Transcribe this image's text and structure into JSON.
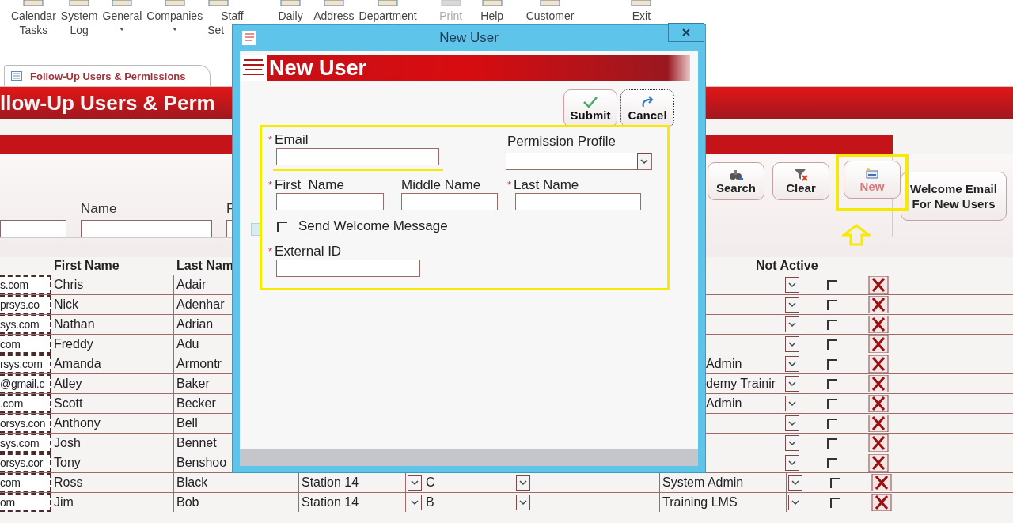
{
  "ribbon": {
    "items": [
      {
        "kind": "button",
        "lines": [
          "Calendar",
          "Tasks"
        ],
        "disabled": false
      },
      {
        "kind": "button",
        "lines": [
          "System",
          "Log"
        ],
        "disabled": false
      },
      {
        "kind": "dropdown",
        "lines": [
          "General"
        ],
        "disabled": false
      },
      {
        "kind": "dropdown",
        "lines": [
          "Companies"
        ],
        "disabled": false
      },
      {
        "kind": "button",
        "lines": [
          "Staff",
          "Set"
        ],
        "disabled": false
      },
      {
        "kind": "button",
        "lines": [
          "Daily"
        ],
        "disabled": false
      },
      {
        "kind": "button",
        "lines": [
          "Address"
        ],
        "disabled": false
      },
      {
        "kind": "button",
        "lines": [
          "Department"
        ],
        "disabled": false
      },
      {
        "kind": "button",
        "lines": [
          "Print"
        ],
        "disabled": true
      },
      {
        "kind": "button",
        "lines": [
          "Help"
        ],
        "disabled": false
      },
      {
        "kind": "button",
        "lines": [
          "Customer"
        ],
        "disabled": false
      },
      {
        "kind": "button",
        "lines": [
          "Exit"
        ],
        "disabled": false
      }
    ]
  },
  "document_tab": {
    "label": "Follow-Up Users & Permissions"
  },
  "form_title": "llow-Up Users & Perm",
  "search": {
    "fields": [
      {
        "kind": "bare"
      },
      {
        "kind": "labeled",
        "label": "Name"
      },
      {
        "kind": "labeled",
        "label": "F"
      }
    ]
  },
  "buttons": [
    {
      "kind": "search",
      "label": "Search",
      "highlighted": false
    },
    {
      "kind": "clear",
      "label": "Clear",
      "highlighted": false
    },
    {
      "kind": "new",
      "label": "New",
      "highlighted": true
    },
    {
      "kind": "text",
      "label": "Welcome Email For New Users",
      "highlighted": false
    }
  ],
  "table": {
    "columns": {
      "first": "First Name",
      "last": "Last Nam",
      "not_active": "Not Active"
    },
    "rows": [
      {
        "kind": "covered",
        "email": "s.com",
        "first": "Chris",
        "last": "Adair",
        "not_active": false
      },
      {
        "kind": "covered",
        "email": "prsys.co",
        "first": "Nick",
        "last": "Adenhar",
        "not_active": false
      },
      {
        "kind": "covered",
        "email": "sys.com",
        "first": "Nathan",
        "last": "Adrian",
        "not_active": false
      },
      {
        "kind": "covered",
        "email": "com",
        "first": "Freddy",
        "last": "Adu",
        "not_active": false
      },
      {
        "kind": "covered",
        "email": "rsys.com",
        "first": "Amanda",
        "last": "Armontr",
        "profile": "Admin",
        "not_active": false
      },
      {
        "kind": "covered",
        "email": "@gmail.c",
        "first": "Atley",
        "last": "Baker",
        "profile": "demy Trainir",
        "not_active": false
      },
      {
        "kind": "covered",
        "email": ".com",
        "first": "Scott",
        "last": "Becker",
        "profile": "Admin",
        "not_active": false
      },
      {
        "kind": "covered",
        "email": "orsys.con",
        "first": "Anthony",
        "last": "Bell",
        "not_active": false
      },
      {
        "kind": "covered",
        "email": "sys.com",
        "first": "Josh",
        "last": "Bennet",
        "not_active": false
      },
      {
        "kind": "covered",
        "email": "orsys.cor",
        "first": "Tony",
        "last": "Benshoo",
        "not_active": false
      },
      {
        "kind": "full",
        "email": "com",
        "first": "Ross",
        "last": "Black",
        "station": "Station 14",
        "level": "C",
        "profile": "System Admin",
        "not_active": false
      },
      {
        "kind": "full",
        "email": "om",
        "first": "Jim",
        "last": "Bob",
        "station": "Station 14",
        "level": "B",
        "profile": "Training LMS",
        "not_active": false
      }
    ]
  },
  "dialog": {
    "title": "New User",
    "heading": "New User",
    "actions": [
      {
        "kind": "submit",
        "label": "Submit",
        "focused": false
      },
      {
        "kind": "cancel",
        "label": "Cancel",
        "focused": true
      }
    ],
    "email": {
      "required_mark": "*",
      "label": "Email",
      "highlighted": true
    },
    "permission_profile": {
      "label": "Permission Profile"
    },
    "first_name": {
      "required_mark": "*",
      "label": "First  Name"
    },
    "middle_name": {
      "label": "Middle Name"
    },
    "last_name": {
      "required_mark": "*",
      "label": "Last Name"
    },
    "send_welcome": {
      "label": "Send Welcome Message",
      "checked": false
    },
    "external_id": {
      "required_mark": "*",
      "label": "External ID"
    }
  }
}
